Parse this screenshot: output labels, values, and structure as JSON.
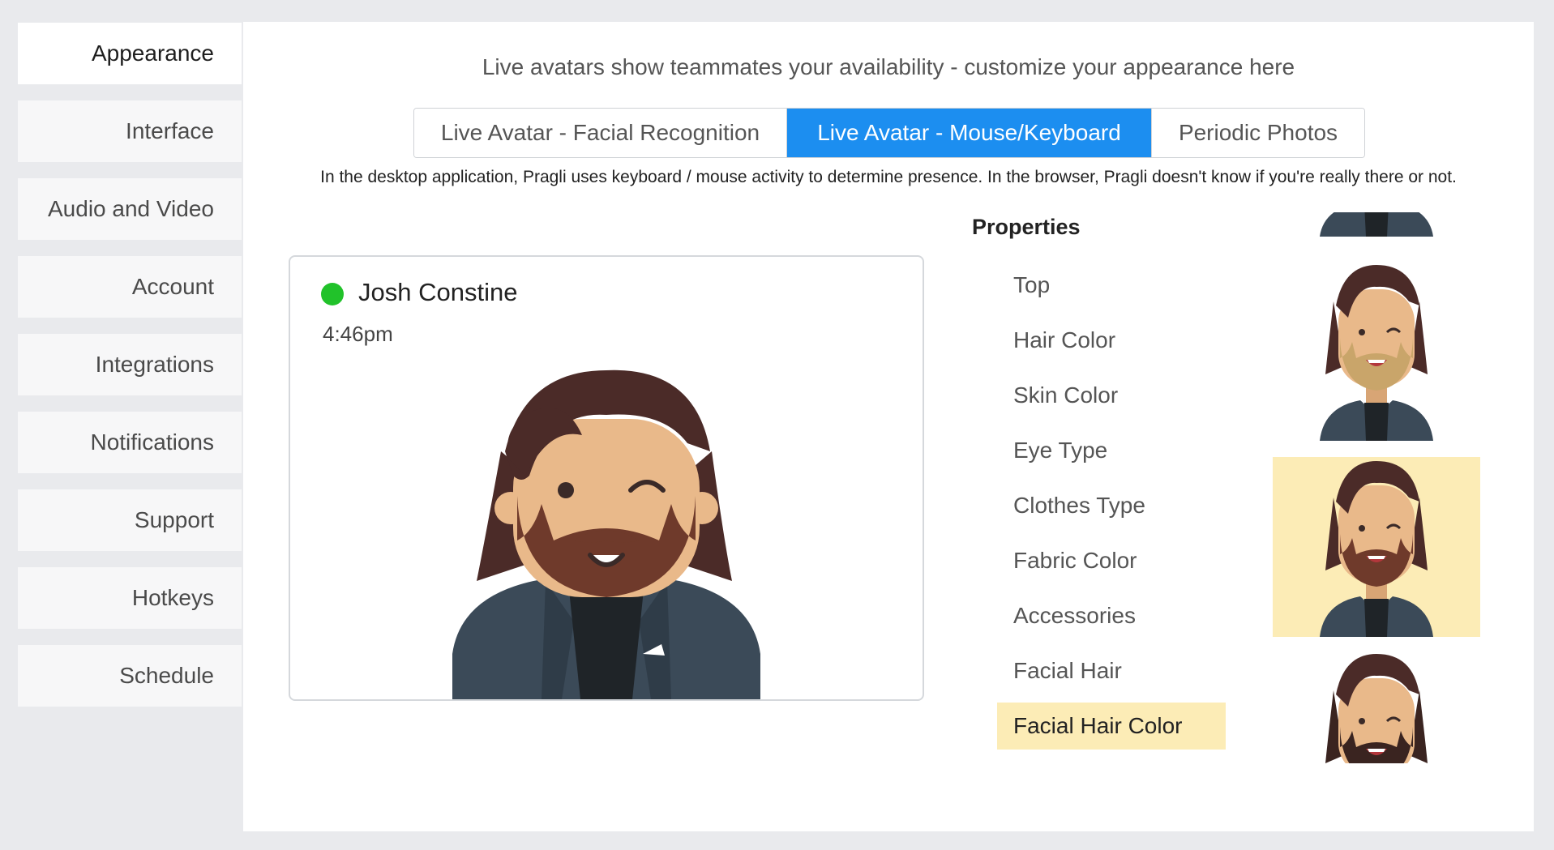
{
  "sidebar": {
    "items": [
      {
        "label": "Appearance"
      },
      {
        "label": "Interface"
      },
      {
        "label": "Audio and Video"
      },
      {
        "label": "Account"
      },
      {
        "label": "Integrations"
      },
      {
        "label": "Notifications"
      },
      {
        "label": "Support"
      },
      {
        "label": "Hotkeys"
      },
      {
        "label": "Schedule"
      }
    ],
    "active": "Appearance"
  },
  "main": {
    "intro": "Live avatars show teammates your availability - customize your appearance here",
    "tabs": [
      {
        "label": "Live Avatar - Facial Recognition"
      },
      {
        "label": "Live Avatar - Mouse/Keyboard"
      },
      {
        "label": "Periodic Photos"
      }
    ],
    "active_tab": "Live Avatar - Mouse/Keyboard",
    "description": "In the desktop application, Pragli uses keyboard / mouse activity to determine presence. In the browser, Pragli doesn't know if you're really there or not."
  },
  "preview": {
    "name": "Josh Constine",
    "time": "4:46pm",
    "status": "online"
  },
  "properties": {
    "title": "Properties",
    "items": [
      {
        "label": "Top"
      },
      {
        "label": "Hair Color"
      },
      {
        "label": "Skin Color"
      },
      {
        "label": "Eye Type"
      },
      {
        "label": "Clothes Type"
      },
      {
        "label": "Fabric Color"
      },
      {
        "label": "Accessories"
      },
      {
        "label": "Facial Hair"
      },
      {
        "label": "Facial Hair Color"
      }
    ],
    "selected": "Facial Hair Color"
  },
  "colors": {
    "accent": "#1c8ef0",
    "online": "#21c22a",
    "selected_bg": "#fcecb6",
    "hair": "#4b2b28",
    "skin": "#e9b98a",
    "beard_brown": "#6f3a2b",
    "beard_blonde": "#c9a56a",
    "jacket": "#3b4a58"
  }
}
